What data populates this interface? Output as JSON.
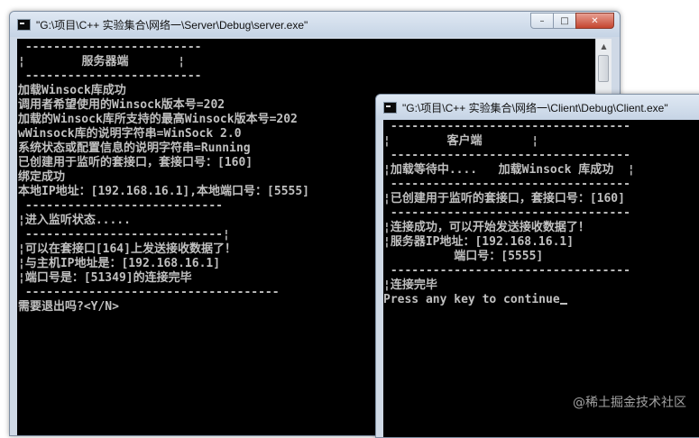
{
  "server_window": {
    "title": "\"G:\\项目\\C++ 实验集合\\网络一\\Server\\Debug\\server.exe\"",
    "buttons": {
      "minimize": "–",
      "maximize": "□",
      "close": "✕"
    },
    "lines": [
      " -------------------------",
      "¦        服务器端       ¦",
      " -------------------------",
      "加载Winsock库成功",
      "调用者希望使用的Winsock版本号=202",
      "加载的Winsock库所支持的最高Winsock版本号=202",
      "wWinsock库的说明字符串=WinSock 2.0",
      "系统状态或配置信息的说明字符串=Running",
      "已创建用于监听的套接口，套接口号：[160]",
      "绑定成功",
      "本地IP地址：[192.168.16.1],本地端口号：[5555]",
      " ----------------------------",
      "¦进入监听状态.....",
      " ----------------------------¦",
      "¦可以在套接口[164]上发送接收数据了！",
      "¦与主机IP地址是：[192.168.16.1]",
      "¦端口号是：[51349]的连接完毕",
      " ------------------------------------",
      "需要退出吗?<Y/N>"
    ]
  },
  "client_window": {
    "title": "\"G:\\项目\\C++ 实验集合\\网络一\\Client\\Debug\\Client.exe\"",
    "lines": [
      " ----------------------------------",
      "¦        客户端       ¦",
      " ----------------------------------",
      "¦加载等待中....   加载Winsock 库成功  ¦",
      " ----------------------------------",
      "¦已创建用于监听的套接口，套接口号：[160]",
      " ----------------------------------",
      "¦连接成功，可以开始发送接收数据了！",
      "¦服务器IP地址：[192.168.16.1]",
      "          端口号：[5555]",
      " ----------------------------------",
      "¦连接完毕",
      "Press any key to continue"
    ]
  },
  "watermark": "@稀土掘金技术社区"
}
